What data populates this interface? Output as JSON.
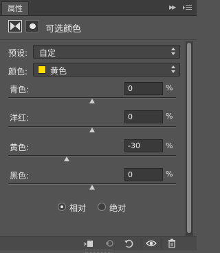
{
  "panel": {
    "tab_label": "属性"
  },
  "header": {
    "title": "可选颜色"
  },
  "preset": {
    "label": "预设:",
    "value": "自定"
  },
  "colors": {
    "label": "颜色:",
    "value": "黄色",
    "swatch_color": "#ffde00"
  },
  "sliders": [
    {
      "label": "青色:",
      "value": "0",
      "unit": "%",
      "level": 0
    },
    {
      "label": "洋红:",
      "value": "0",
      "unit": "%",
      "level": 0
    },
    {
      "label": "黄色:",
      "value": "-30",
      "unit": "%",
      "level": -30
    },
    {
      "label": "黑色:",
      "value": "0",
      "unit": "%",
      "level": 0
    }
  ],
  "method": {
    "relative": "相对",
    "absolute": "绝对",
    "selected": "relative"
  }
}
